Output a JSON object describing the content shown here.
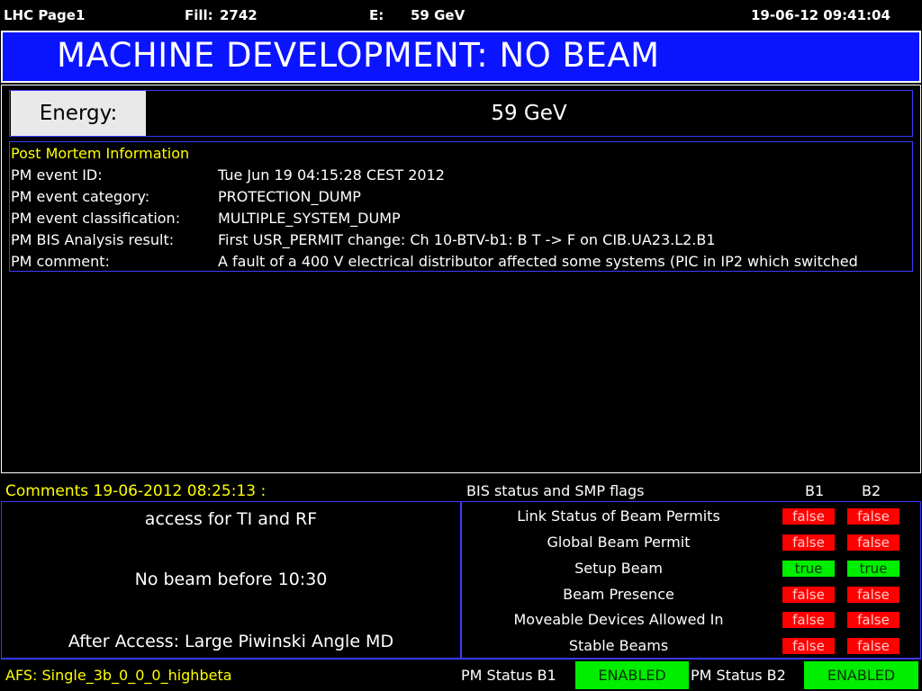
{
  "header": {
    "page": "LHC Page1",
    "fill_label": "Fill:",
    "fill_value": "2742",
    "energy_label": "E:",
    "energy_value": "59 GeV",
    "datetime": "19-06-12 09:41:04"
  },
  "banner": {
    "title": "MACHINE DEVELOPMENT: NO BEAM"
  },
  "energy": {
    "label": "Energy:",
    "value": "59 GeV"
  },
  "post_mortem": {
    "title": "Post Mortem Information",
    "rows": [
      {
        "label": "PM event ID:",
        "value": "Tue Jun 19 04:15:28 CEST 2012"
      },
      {
        "label": "PM event category:",
        "value": "PROTECTION_DUMP"
      },
      {
        "label": "PM event classification:",
        "value": "MULTIPLE_SYSTEM_DUMP"
      },
      {
        "label": "PM BIS Analysis result:",
        "value": "First USR_PERMIT change: Ch 10-BTV-b1: B T -> F on CIB.UA23.L2.B1"
      },
      {
        "label": "PM comment:",
        "value": "A fault of a 400 V electrical distributor affected some systems (PIC in IP2 which switched"
      }
    ]
  },
  "comments": {
    "title": "Comments 19-06-2012 08:25:13 :",
    "lines": [
      "access for TI and RF",
      "No beam before 10:30",
      "After Access: Large Piwinski Angle MD"
    ]
  },
  "bis": {
    "title": "BIS status and SMP flags",
    "b1_header": "B1",
    "b2_header": "B2",
    "flags": [
      {
        "label": "Link Status of Beam Permits",
        "b1": "false",
        "b2": "false"
      },
      {
        "label": "Global Beam Permit",
        "b1": "false",
        "b2": "false"
      },
      {
        "label": "Setup Beam",
        "b1": "true",
        "b2": "true"
      },
      {
        "label": "Beam Presence",
        "b1": "false",
        "b2": "false"
      },
      {
        "label": "Moveable Devices Allowed In",
        "b1": "false",
        "b2": "false"
      },
      {
        "label": "Stable Beams",
        "b1": "false",
        "b2": "false"
      }
    ]
  },
  "footer": {
    "afs": "AFS: Single_3b_0_0_0_highbeta",
    "pm_b1_label": "PM Status B1",
    "pm_b1_value": "ENABLED",
    "pm_b2_label": "PM Status B2",
    "pm_b2_value": "ENABLED"
  },
  "colors": {
    "banner_bg": "#0a14ff",
    "frame_blue": "#3b3bff",
    "highlight_yellow": "#ffff00",
    "true_green": "#00ee00",
    "false_red": "#ff0000"
  }
}
